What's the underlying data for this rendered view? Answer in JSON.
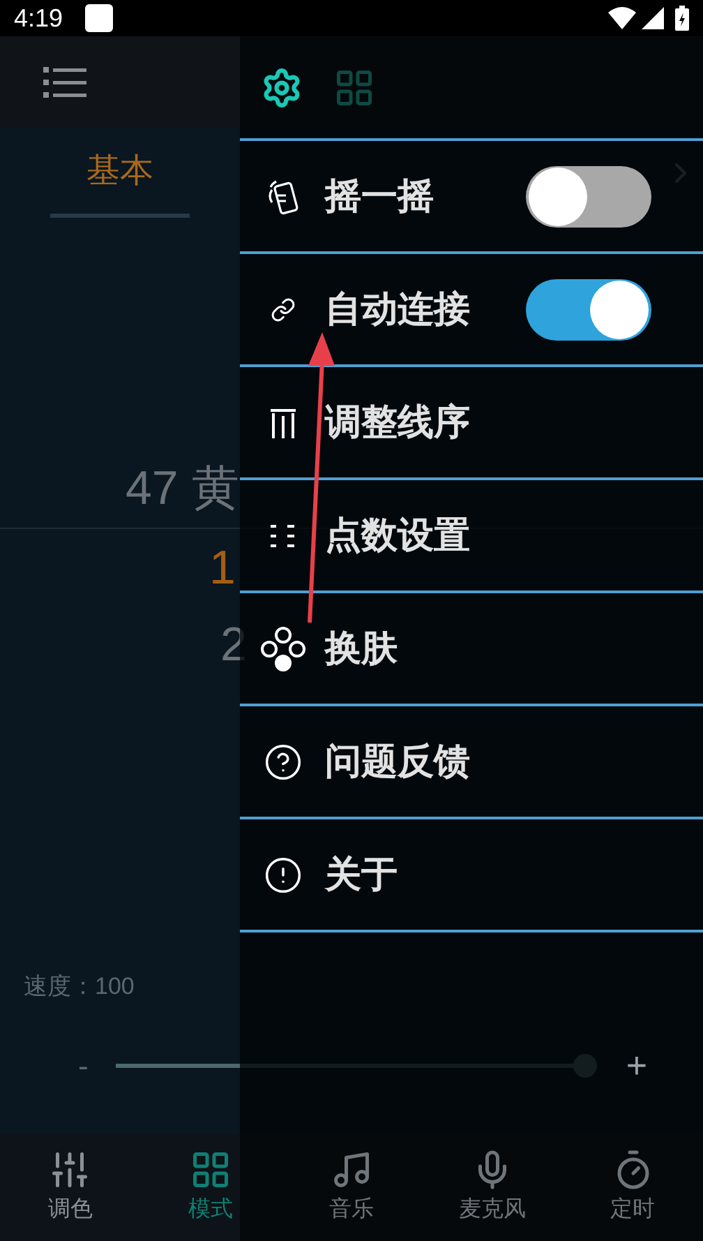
{
  "status_bar": {
    "time": "4:19"
  },
  "tabs": [
    {
      "label": "基本",
      "selected": true
    }
  ],
  "mode_list": [
    {
      "text": "47 黄",
      "kind": "plain"
    },
    {
      "text": "1",
      "kind": "current"
    },
    {
      "text": "2",
      "kind": "plain"
    }
  ],
  "speed": {
    "label": "速度：100",
    "level": 1
  },
  "slider_minus": "-",
  "slider_plus": "+",
  "bottom_nav": [
    {
      "label": "调色",
      "selected": false
    },
    {
      "label": "模式",
      "selected": true
    },
    {
      "label": "音乐",
      "selected": false
    },
    {
      "label": "麦克风",
      "selected": false
    },
    {
      "label": "定时",
      "selected": false
    }
  ],
  "drawer": {
    "tabs": [
      {
        "selected": true
      },
      {
        "selected": false
      }
    ],
    "items": [
      {
        "label": "摇一摇",
        "kind": "toggle",
        "on": false
      },
      {
        "label": "自动连接",
        "kind": "toggle",
        "on": true
      },
      {
        "label": "调整线序",
        "kind": "link"
      },
      {
        "label": "点数设置",
        "kind": "link"
      },
      {
        "label": "换肤",
        "kind": "link"
      },
      {
        "label": "问题反馈",
        "kind": "link"
      },
      {
        "label": "关于",
        "kind": "link"
      }
    ]
  }
}
